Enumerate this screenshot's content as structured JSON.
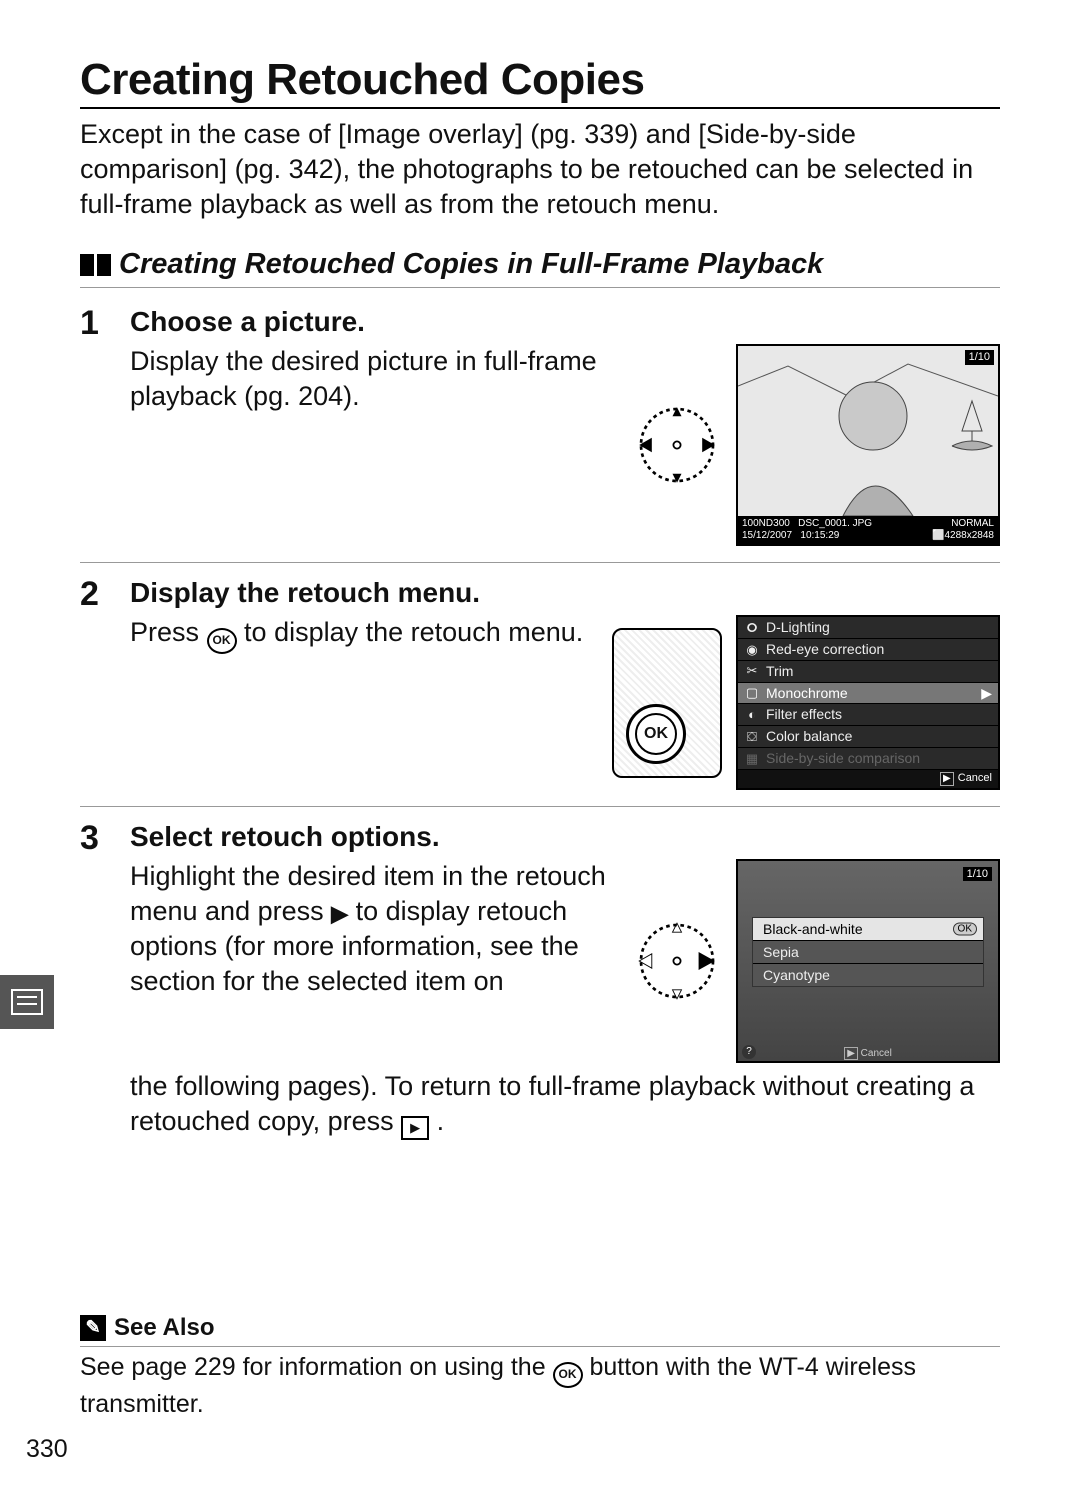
{
  "title": "Creating Retouched Copies",
  "intro": "Except in the case of [Image overlay] (pg. 339) and [Side-by-side comparison] (pg. 342), the photographs to be retouched can be selected in full-frame playback as well as from the retouch menu.",
  "subheading": "Creating Retouched Copies in Full-Frame Playback",
  "steps": {
    "s1": {
      "num": "1",
      "title": "Choose a picture.",
      "text": "Display the desired picture in full-frame playback (pg. 204)."
    },
    "s2": {
      "num": "2",
      "title": "Display the retouch menu.",
      "text_a": "Press ",
      "text_b": " to display the retouch menu."
    },
    "s3": {
      "num": "3",
      "title": "Select retouch options.",
      "text_a": "Highlight the desired item in the retouch menu and press ",
      "text_b": " to display retouch options (for more information, see the section for the selected item on",
      "text_c": "the following pages).  To return to full-frame playback without creating a retouched copy, press ",
      "text_d": "."
    }
  },
  "screen1": {
    "counter": "1/10",
    "status": {
      "folder": "100ND300",
      "file": "DSC_0001. JPG",
      "date": "15/12/2007",
      "time": "10:15:29",
      "quality": "NORMAL",
      "size": "⬜4288x2848"
    }
  },
  "retouch_menu": {
    "items": [
      {
        "icon": "🞇",
        "label": "D-Lighting"
      },
      {
        "icon": "◉",
        "label": "Red-eye correction"
      },
      {
        "icon": "✂",
        "label": "Trim"
      },
      {
        "icon": "▢",
        "label": "Monochrome",
        "hl": true
      },
      {
        "icon": "◐",
        "label": "Filter effects"
      },
      {
        "icon": "⛋",
        "label": "Color balance"
      },
      {
        "icon": "▦",
        "label": "Side-by-side comparison",
        "dim": true
      }
    ],
    "cancel": "Cancel"
  },
  "options_screen": {
    "counter": "1/10",
    "items": [
      "Black-and-white",
      "Sepia",
      "Cyanotype"
    ],
    "ok": "OK",
    "cancel": "Cancel"
  },
  "ok_label": "OK",
  "see_also": {
    "heading": "See Also",
    "text_a": "See page 229 for information on using the ",
    "text_b": " button with the WT-4 wireless transmitter."
  },
  "page_number": "330"
}
